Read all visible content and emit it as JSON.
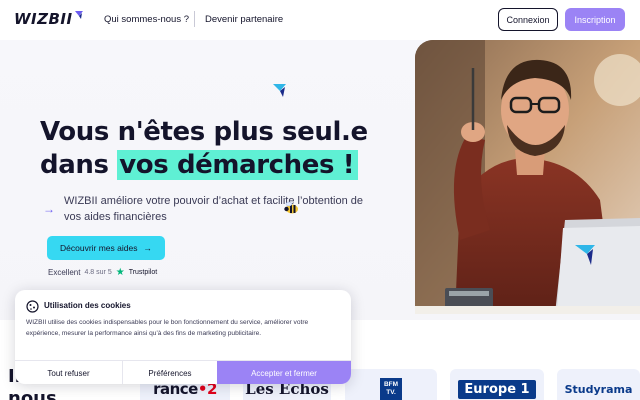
{
  "header": {
    "logo_text": "WIZBII",
    "nav": [
      {
        "label": "Qui sommes-nous ?"
      },
      {
        "label": "Devenir partenaire"
      }
    ],
    "login_label": "Connexion",
    "signup_label": "Inscription"
  },
  "hero": {
    "title_line1": "Vous n'êtes plus seul.e",
    "title_line2_prefix": "dans ",
    "title_highlight": "vos démarches !",
    "subtitle": "WIZBII améliore votre pouvoir d’achat et facilite l’obtention de vos aides financières",
    "cta_label": "Découvrir mes aides",
    "cta_arrow": "→",
    "trust_rating": "Excellent",
    "trust_score": "4.8 sur 5",
    "trust_brand": "Trustpilot"
  },
  "media": {
    "title": "Ils\nnous",
    "logos": [
      {
        "name": "france2",
        "text_a": "rance",
        "text_b": "•2"
      },
      {
        "name": "lesechos",
        "text": "Les Echos"
      },
      {
        "name": "bfmtv",
        "text_a": "BFM",
        "text_b": "TV."
      },
      {
        "name": "europe1",
        "text": "Europe 1"
      },
      {
        "name": "studyrama",
        "text": "Studyrama"
      }
    ]
  },
  "cookie": {
    "title": "Utilisation des cookies",
    "text": "WIZBII utilise des cookies indispensables pour le bon fonctionnement du service, améliorer votre expérience, mesurer la performance ainsi qu'à des fins de marketing publicitaire.",
    "refuse_label": "Tout refuser",
    "prefs_label": "Préférences",
    "accept_label": "Accepter et fermer"
  },
  "colors": {
    "accent_purple": "#9b83f5",
    "highlight_mint": "#5ff0d4",
    "cta_cyan": "#36d8f2",
    "trustpilot_green": "#00b67a",
    "text_dark": "#14142b"
  },
  "icons": {
    "brand_mark": "wizbii-mark-icon",
    "arrow": "arrow-right-icon",
    "bee": "bee-icon",
    "star": "trustpilot-star-icon",
    "cookie": "cookie-icon"
  }
}
